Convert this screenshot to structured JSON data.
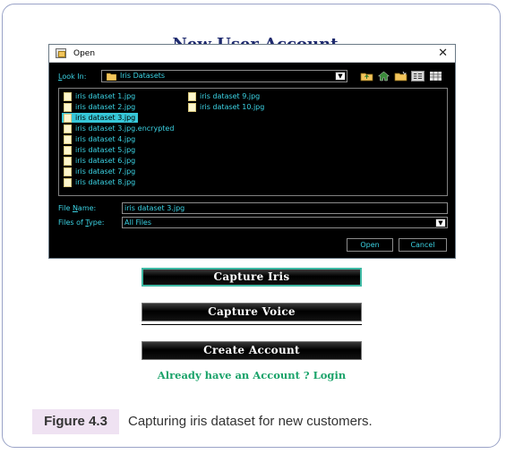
{
  "page": {
    "behind_title": "New User Account",
    "buttons": {
      "capture_iris": "Capture Iris",
      "capture_voice": "Capture Voice",
      "create_account": "Create Account"
    },
    "login_link": "Already have an Account ? Login",
    "caption": {
      "label": "Figure 4.3",
      "text": "Capturing iris dataset for new customers."
    }
  },
  "dialog": {
    "title": "Open",
    "close_glyph": "✕",
    "look_in_label_u": "L",
    "look_in_label_rest": "ook In:",
    "look_in_value": "Iris Datasets",
    "files_col1": [
      "iris dataset 1.jpg",
      "iris dataset 2.jpg",
      "iris dataset 3.jpg",
      "iris dataset 3.jpg.encrypted",
      "iris dataset 4.jpg",
      "iris dataset 5.jpg",
      "iris dataset 6.jpg",
      "iris dataset 7.jpg",
      "iris dataset 8.jpg"
    ],
    "files_col2": [
      "iris dataset 9.jpg",
      "iris dataset 10.jpg"
    ],
    "selected_file": "iris dataset 3.jpg",
    "file_name_label_pre": "File ",
    "file_name_label_u": "N",
    "file_name_label_post": "ame:",
    "file_name_value": "iris dataset 3.jpg",
    "files_of_type_label_pre": "Files of ",
    "files_of_type_label_u": "T",
    "files_of_type_label_post": "ype:",
    "files_of_type_value": "All Files",
    "open_button": "Open",
    "cancel_button": "Cancel",
    "toolbar_icons": [
      "up-folder-icon",
      "home-icon",
      "new-folder-icon",
      "list-view-icon",
      "details-view-icon"
    ],
    "colors": {
      "accent": "#3bd2e3",
      "selected_bg": "#37c7d8",
      "background": "#000000"
    }
  }
}
